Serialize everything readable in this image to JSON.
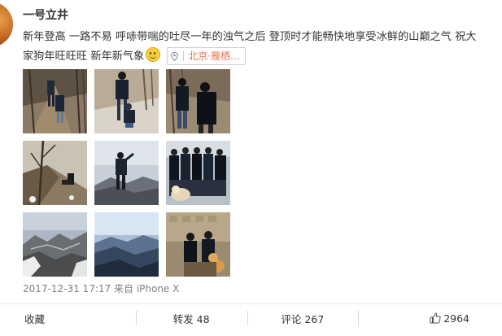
{
  "post": {
    "author": "一号立井",
    "text_line1": "新年登高 一路不易 呼哧带喘的吐尽一年的浊气之后 登顶时才能畅快地享受冰鲜的山巅之气 祝大",
    "text_line2": "家狗年旺旺旺 新年新气象",
    "emoji": "smile-emoji",
    "location": "北京·雁栖...",
    "timestamp": "2017-12-31 17:17",
    "source_prefix": "来自",
    "source": "iPhone X"
  },
  "photos": [
    {
      "name": "photo-1",
      "scene": "two people hiking up steep dirt trail in forest"
    },
    {
      "name": "photo-2",
      "scene": "adult with child on snowy hillside trail"
    },
    {
      "name": "photo-3",
      "scene": "couple in black down jackets on mountain"
    },
    {
      "name": "photo-4",
      "scene": "dog on rocky snowy slope with bare tree"
    },
    {
      "name": "photo-5",
      "scene": "person standing on summit overlooking valley"
    },
    {
      "name": "photo-6",
      "scene": "group of hikers with dog posing"
    },
    {
      "name": "photo-7",
      "scene": "great wall on snowy mountain ridge"
    },
    {
      "name": "photo-8",
      "scene": "blue mountain landscape from summit"
    },
    {
      "name": "photo-9",
      "scene": "two people sitting on wall with shiba dog"
    }
  ],
  "actions": {
    "favorite": "收藏",
    "repost": "转发 48",
    "comment": "评论 267",
    "like": "2964"
  },
  "colors": {
    "location_text": "#eb7350",
    "meta_text": "#808080",
    "body_text": "#333333"
  }
}
